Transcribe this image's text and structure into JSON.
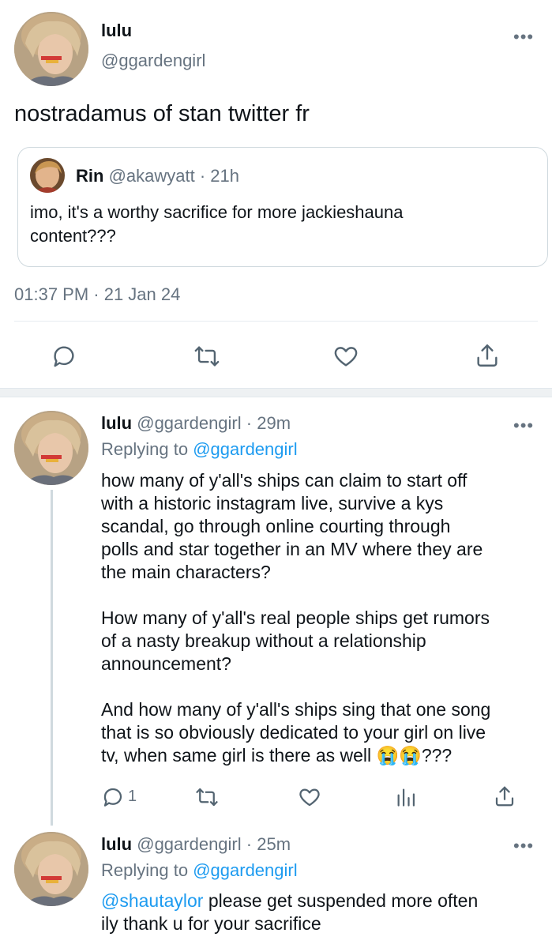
{
  "main_tweet": {
    "author_name": "lulu",
    "author_handle": "@ggardengirl",
    "text": "nostradamus of stan twitter fr",
    "timestamp": "01:37 PM · 21 Jan 24",
    "more_icon": "more-dots-icon"
  },
  "quoted_tweet": {
    "author_name": "Rin",
    "author_handle": "@akawyatt",
    "time": "· 21h",
    "line1": "imo, it's a worthy sacrifice for more jackieshauna",
    "line2": "content???"
  },
  "main_actions": [
    "reply-icon",
    "retweet-icon",
    "like-icon",
    "share-icon"
  ],
  "replies": [
    {
      "author_name": "lulu",
      "author_handle": "@ggardengirl",
      "time": "· 29m",
      "replying_to_label": "Replying to",
      "replying_to_handle": "@ggardengirl",
      "p1": [
        "how many of y'all's ships can claim to start off",
        "with a historic instagram live, survive a kys",
        "scandal, go through online courting through",
        "polls and star together in an MV where they are",
        "the main characters?"
      ],
      "p2": [
        "How many of y'all's real people ships get rumors",
        "of a nasty breakup without a relationship",
        "announcement?"
      ],
      "p3": [
        "And how many of y'all's ships sing that one song",
        "that is so obviously dedicated to your girl on live",
        "tv, when same girl is there as well"
      ],
      "p3_emoji": "😭😭",
      "p3_tail": "???",
      "reply_count": "1"
    },
    {
      "author_name": "lulu",
      "author_handle": "@ggardengirl",
      "time": "· 25m",
      "replying_to_label": "Replying to",
      "replying_to_handle": "@ggardengirl",
      "mention": "@shautaylor",
      "line1_rest": " please get suspended more often",
      "line2": "ily thank u for your sacrifice"
    }
  ],
  "colors": {
    "accent": "#1d9bf0",
    "muted": "#667380",
    "divider": "#e6ecf0",
    "text": "#0f1419"
  }
}
